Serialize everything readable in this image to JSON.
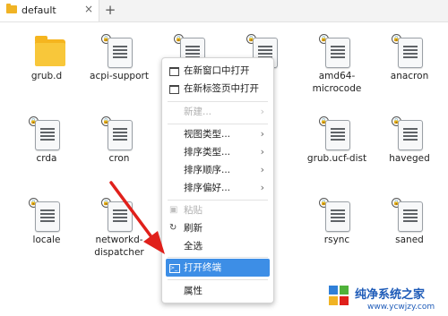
{
  "tab": {
    "title": "default",
    "close_glyph": "×",
    "add_glyph": "+"
  },
  "files": [
    {
      "name": "grub.d",
      "icon": "folder-icon"
    },
    {
      "name": "acpi-support",
      "icon": "document-icon"
    },
    {
      "name": "",
      "icon": "document-icon"
    },
    {
      "name": "",
      "icon": "document-icon"
    },
    {
      "name": "amd64-microcode",
      "icon": "document-icon"
    },
    {
      "name": "anacron",
      "icon": "document-icon"
    },
    {
      "name": "crda",
      "icon": "document-icon"
    },
    {
      "name": "cron",
      "icon": "document-icon"
    },
    {
      "name": "grub.ucf-dist",
      "icon": "document-icon"
    },
    {
      "name": "haveged",
      "icon": "document-icon"
    },
    {
      "name": "locale",
      "icon": "document-icon"
    },
    {
      "name": "networkd-dispatcher",
      "icon": "document-icon"
    },
    {
      "name": "rsync",
      "icon": "document-icon"
    },
    {
      "name": "saned",
      "icon": "document-icon"
    }
  ],
  "context_menu": {
    "open_new_window": "在新窗口中打开",
    "open_new_tab": "在新标签页中打开",
    "new": "新建...",
    "view_type": "视图类型...",
    "sort_type": "排序类型...",
    "sort_order": "排序顺序...",
    "sort_pref": "排序偏好...",
    "paste": "粘贴",
    "refresh": "刷新",
    "select_all": "全选",
    "open_terminal": "打开终端",
    "properties": "属性",
    "arrow": "›"
  },
  "watermark": {
    "title": "纯净系统之家",
    "url": "www.ycwjzy.com"
  },
  "colors": {
    "highlight": "#3d8ee6",
    "arrow": "#e0201b",
    "folder": "#f5b51f"
  }
}
